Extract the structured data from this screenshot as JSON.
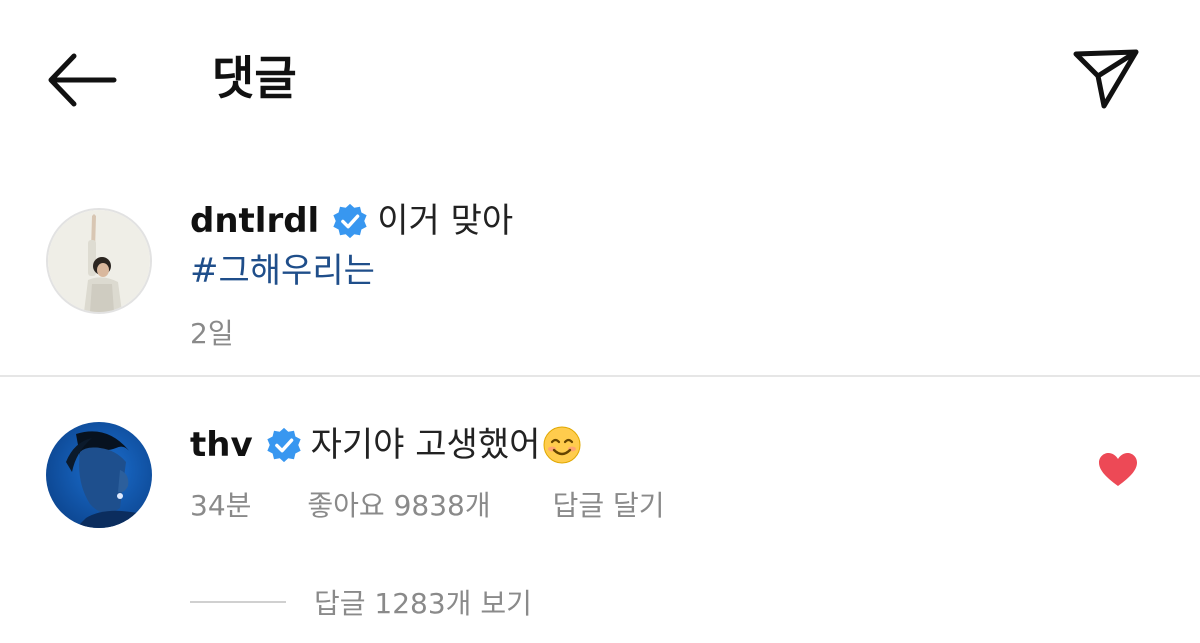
{
  "header": {
    "back_icon": "arrow-left-icon",
    "title": "댓글",
    "share_icon": "paper-plane-icon"
  },
  "comments": [
    {
      "username": "dntlrdl",
      "verified": true,
      "text": "이거 맞아",
      "hashtag": "#그해우리는",
      "time": "2일"
    },
    {
      "username": "thv",
      "verified": true,
      "text": "자기야 고생했어",
      "emoji": "smiling-face-icon",
      "time": "34분",
      "likes": "좋아요 9838개",
      "reply": "답글 달기",
      "liked": true,
      "view_replies": "답글 1283개 보기"
    }
  ],
  "colors": {
    "verified_blue": "#3897f0",
    "hashtag_blue": "#1f4e8a",
    "heart_red": "#ed4956",
    "meta_gray": "#8a8a8a"
  }
}
